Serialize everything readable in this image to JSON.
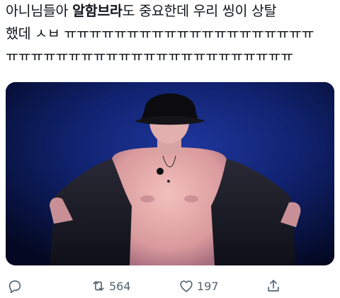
{
  "tweet": {
    "line1_pre": "아니님들아 ",
    "line1_bold": "알함브라",
    "line1_post": "도 중요한데 우리 씽이 상탈",
    "line2": "했데 ㅅㅂ ㅠㅠㅠㅠㅠㅠㅠㅠㅠㅠㅠㅠㅠㅠㅠㅠㅠㅠㅠㅠ",
    "line3": "ㅠㅠㅠㅠㅠㅠㅠㅠㅠㅠㅠㅠㅠㅠㅠㅠㅠㅠㅠㅠㅠㅠㅠ"
  },
  "actions": {
    "reply": {
      "icon": "reply-icon"
    },
    "retweet": {
      "icon": "retweet-icon",
      "count": "564"
    },
    "like": {
      "icon": "heart-icon",
      "count": "197"
    },
    "share": {
      "icon": "share-icon"
    }
  },
  "colors": {
    "text": "#0f1419",
    "action_gray": "#536471",
    "photo_background": "#0a1a5c"
  }
}
